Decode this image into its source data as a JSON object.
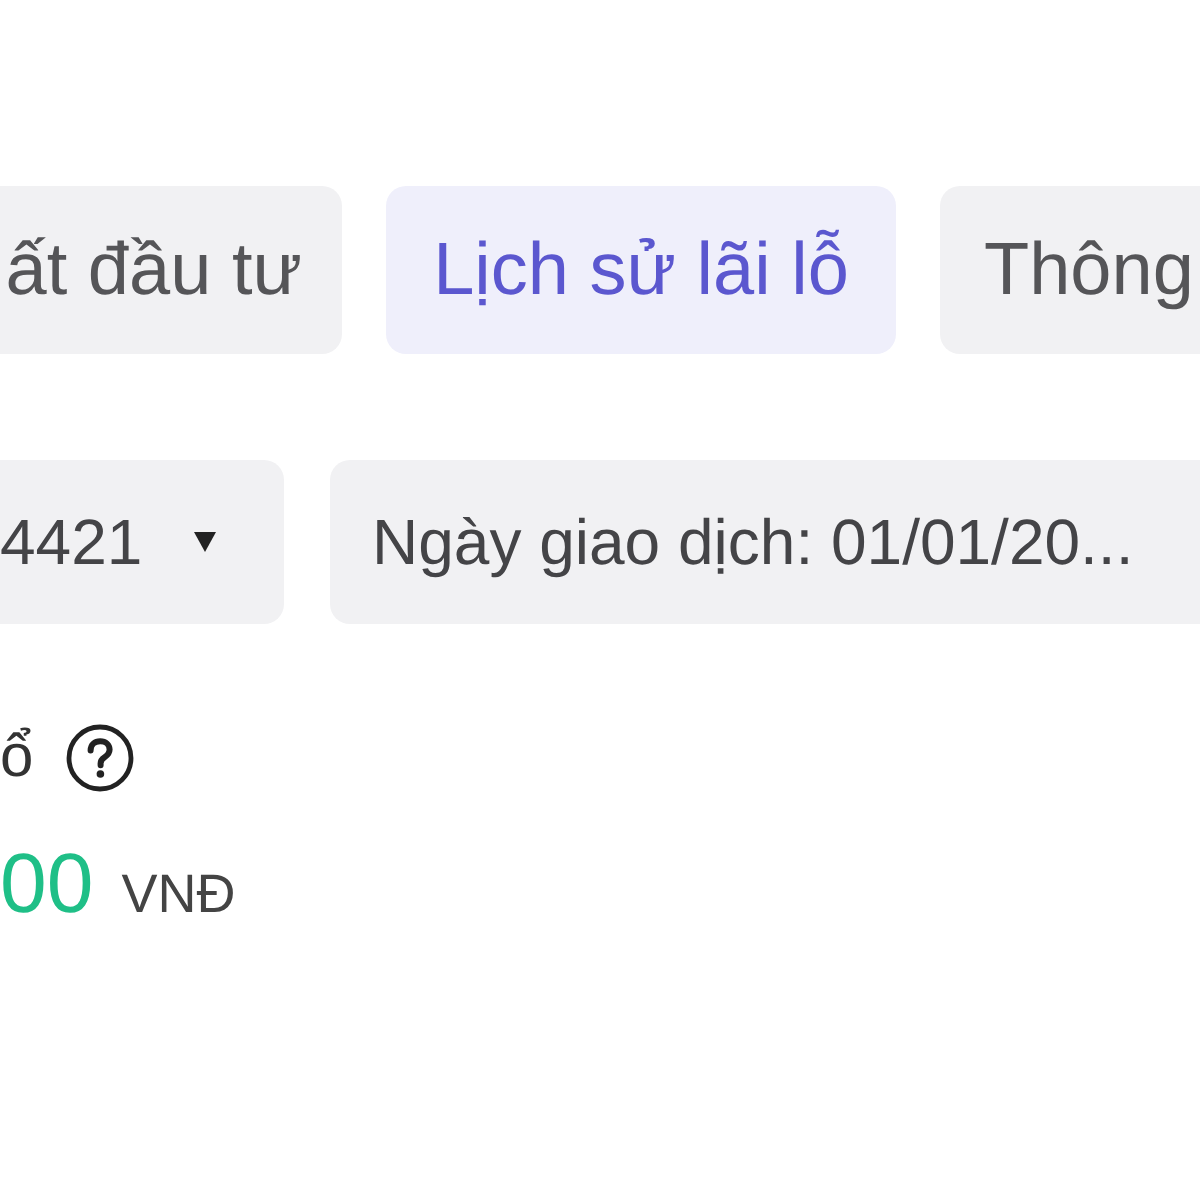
{
  "tabs": [
    {
      "label": "ất đầu tư",
      "selected": false
    },
    {
      "label": "Lịch sử lãi lỗ",
      "selected": true
    },
    {
      "label": "Thông",
      "selected": false
    }
  ],
  "filters": {
    "account": {
      "value": "4421"
    },
    "date": {
      "value": "Ngày giao dịch: 01/01/20..."
    }
  },
  "summary": {
    "label": "ổ",
    "amount": "00",
    "currency": "VNĐ"
  }
}
